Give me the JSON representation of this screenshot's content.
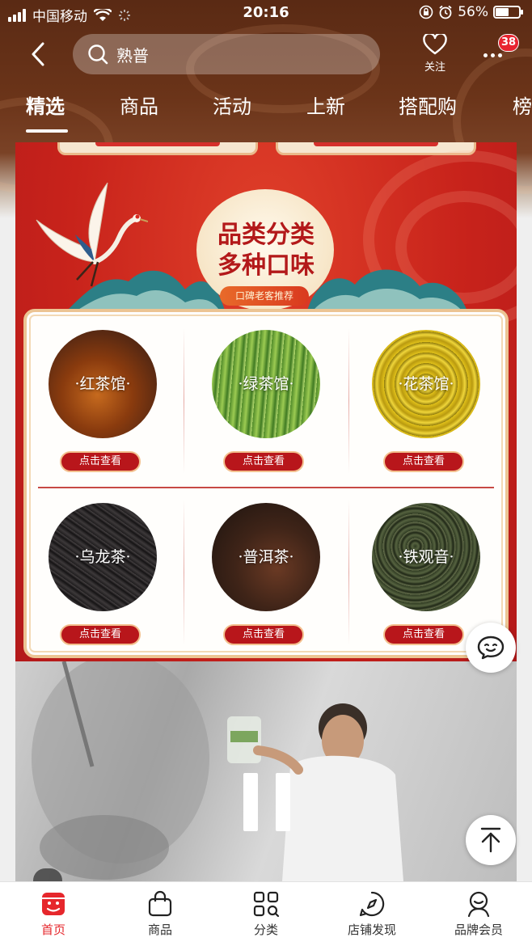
{
  "status_bar": {
    "carrier": "中国移动",
    "time": "20:16",
    "battery_percent": "56%",
    "battery_level": 0.56
  },
  "nav": {
    "search_text": "熟普",
    "follow_label": "关注",
    "message_count": "38"
  },
  "tabs": [
    {
      "label": "精选",
      "active": true
    },
    {
      "label": "商品"
    },
    {
      "label": "活动"
    },
    {
      "label": "上新"
    },
    {
      "label": "搭配购"
    },
    {
      "label": "榜"
    }
  ],
  "banner": {
    "title_line1": "品类分类",
    "title_line2": "多种口味",
    "subtitle": "口碑老客推荐",
    "categories": [
      {
        "name": "·红茶馆·",
        "button": "点击查看"
      },
      {
        "name": "·绿茶馆·",
        "button": "点击查看"
      },
      {
        "name": "·花茶馆·",
        "button": "点击查看"
      },
      {
        "name": "·乌龙茶·",
        "button": "点击查看"
      },
      {
        "name": "·普洱茶·",
        "button": "点击查看"
      },
      {
        "name": "·铁观音·",
        "button": "点击查看"
      }
    ]
  },
  "tab_bar": [
    {
      "label": "首页",
      "icon": "store-icon",
      "active": true
    },
    {
      "label": "商品",
      "icon": "bag-icon"
    },
    {
      "label": "分类",
      "icon": "grid-icon"
    },
    {
      "label": "店铺发现",
      "icon": "compass-icon"
    },
    {
      "label": "品牌会员",
      "icon": "member-icon"
    }
  ],
  "colors": {
    "accent": "#e6272c",
    "banner_red": "#c8231b",
    "gold_border": "#ecc493",
    "header_brown": "#6b3419"
  }
}
